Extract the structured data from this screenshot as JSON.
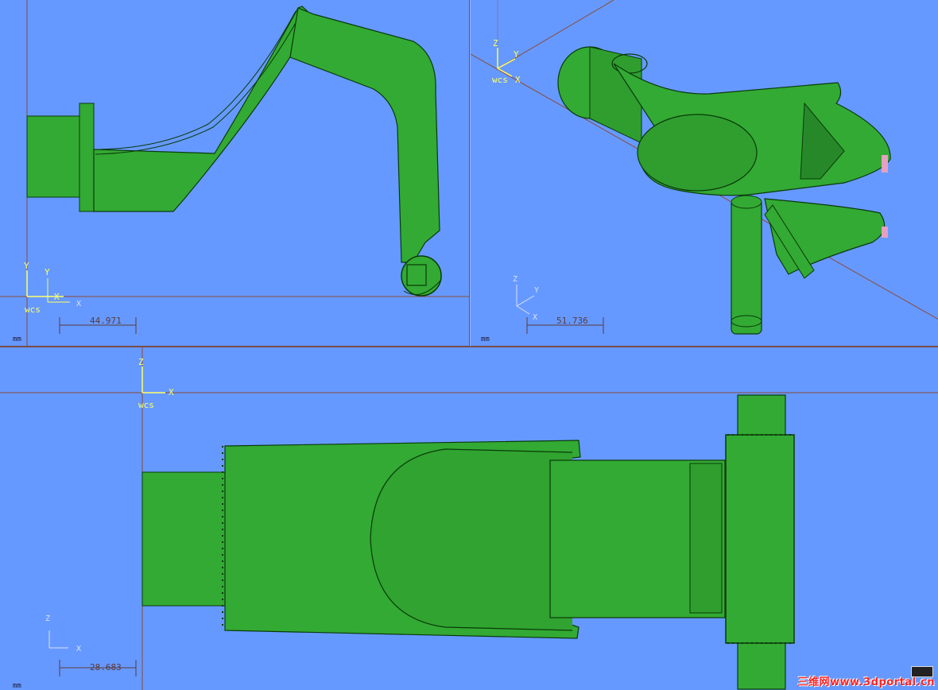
{
  "viewports": {
    "side": {
      "axis": {
        "y1": "Y",
        "y2": "Y",
        "x": "X",
        "wcs": "wcs"
      },
      "scale_value": "44.971",
      "unit": "mm"
    },
    "iso": {
      "axis_top": {
        "z": "Z",
        "y": "Y",
        "x": "X",
        "wcs": "wcs"
      },
      "axis_bottom": {
        "z": "Z",
        "y": "Y",
        "x": "X"
      },
      "scale_value": "51.736",
      "unit": "mm"
    },
    "top": {
      "axis_top": {
        "z": "Z",
        "x": "X",
        "wcs": "wcs"
      },
      "axis_bottom": {
        "z": "Z",
        "x": "X"
      },
      "scale_value": "28.683",
      "unit": "mm"
    }
  },
  "colors": {
    "background": "#6699ff",
    "model_green": "#33aa33",
    "model_edge": "#0a3a0a",
    "axis_yellow": "#ffff66",
    "grid_line": "#8a4a3a"
  },
  "watermark": {
    "text": "三维网www.3dportal.cn"
  }
}
